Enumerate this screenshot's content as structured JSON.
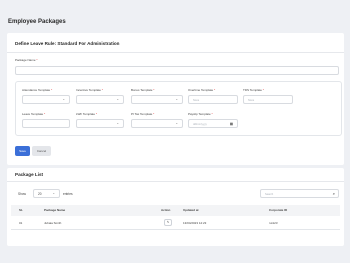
{
  "page": {
    "title": "Employee Packages"
  },
  "form": {
    "title": "Define Leave Rule: Standard For Administration",
    "package_name": {
      "label": "Package Name",
      "value": "",
      "placeholder": ""
    },
    "templates_row1": [
      {
        "label": "Attendance Template",
        "placeholder": ""
      },
      {
        "label": "Incentive Template",
        "placeholder": ""
      },
      {
        "label": "Bonus Template",
        "placeholder": ""
      },
      {
        "label": "Overtime Template",
        "placeholder": "None"
      },
      {
        "label": "TDS Template",
        "placeholder": "None"
      }
    ],
    "templates_row2": [
      {
        "label": "Leave Template",
        "placeholder": ""
      },
      {
        "label": "LWF Template",
        "placeholder": ""
      },
      {
        "label": "PI Tax Template",
        "placeholder": ""
      },
      {
        "label": "Payslip Template",
        "placeholder": "dd/mm/yyyy"
      }
    ],
    "save_label": "Save",
    "cancel_label": "Cancel"
  },
  "list": {
    "title": "Package List",
    "show_label": "Show",
    "entries_value": "20",
    "entries_label": "entries",
    "search_placeholder": "Search",
    "columns": [
      "SL",
      "Package Name",
      "Action",
      "Updated at",
      "Corporate ID"
    ],
    "rows": [
      {
        "sl": "01",
        "name": "Jubaia Smith",
        "updated": "13/04/2023 12:23",
        "corporate_id": "rut123"
      }
    ]
  },
  "icons": {
    "chevron": "chevron-down-icon",
    "calendar": "calendar-icon",
    "search": "search-icon",
    "edit": "edit-icon"
  }
}
